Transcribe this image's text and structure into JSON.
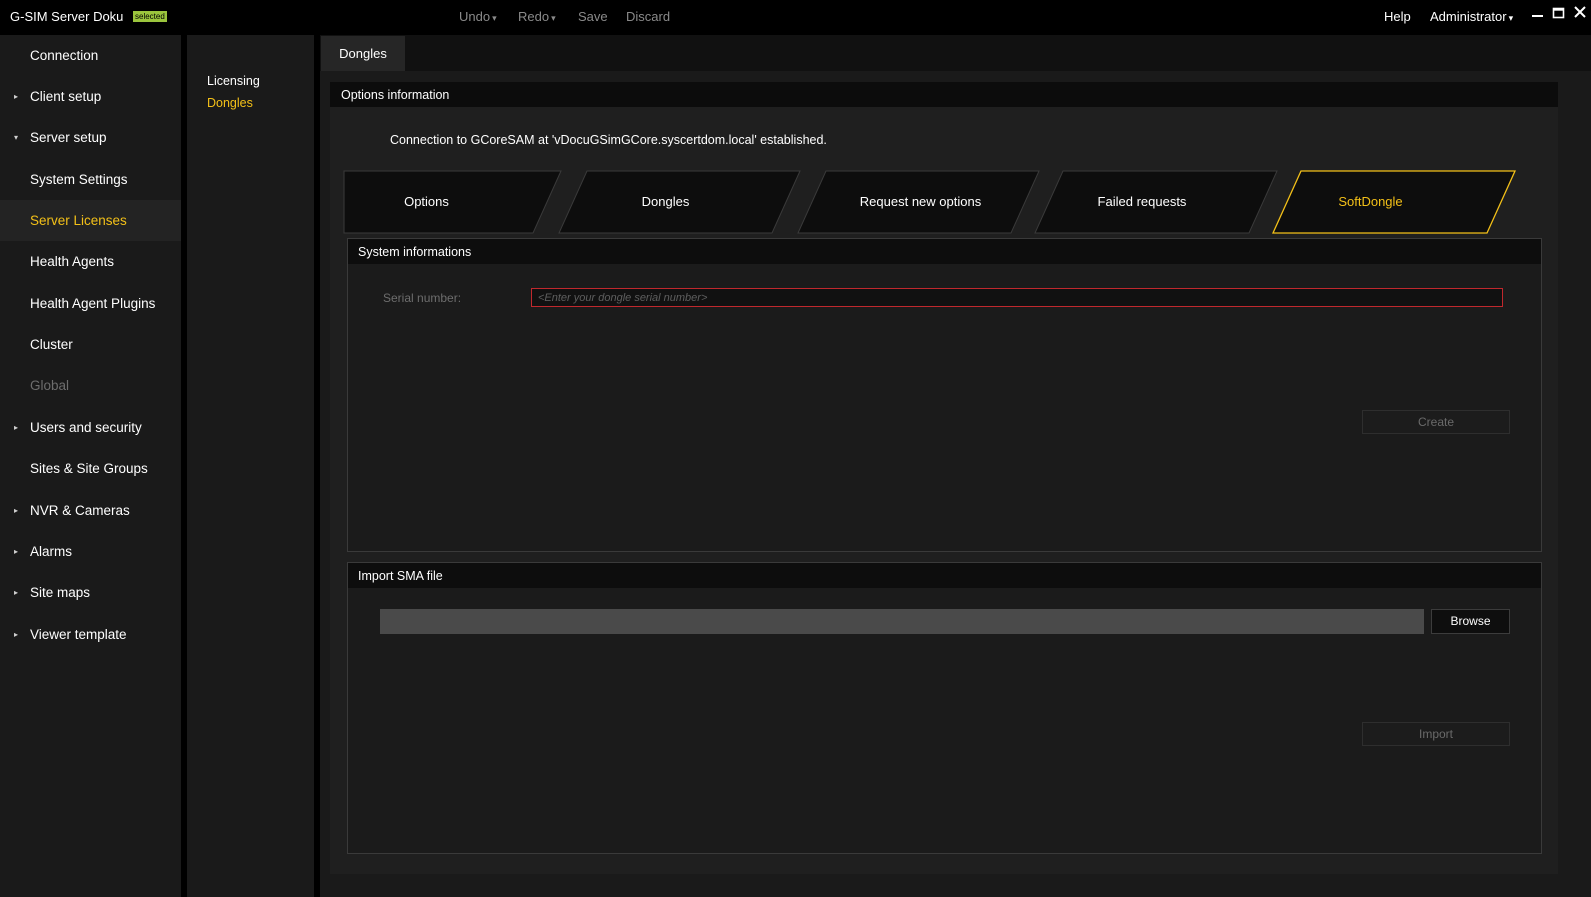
{
  "titlebar": {
    "app_title": "G-SIM Server Doku",
    "badge": "selected",
    "undo": "Undo",
    "redo": "Redo",
    "save": "Save",
    "discard": "Discard",
    "help": "Help",
    "user": "Administrator",
    "dropdown_glyph": "▾"
  },
  "sidebar": {
    "items": [
      {
        "label": "Connection"
      },
      {
        "label": "Client setup",
        "arrow": "▸"
      },
      {
        "label": "Server setup",
        "arrow": "▾"
      },
      {
        "label": "System Settings"
      },
      {
        "label": "Server Licenses"
      },
      {
        "label": "Health Agents"
      },
      {
        "label": "Health Agent Plugins"
      },
      {
        "label": "Cluster"
      },
      {
        "label": "Global"
      },
      {
        "label": "Users and security",
        "arrow": "▸"
      },
      {
        "label": "Sites & Site Groups"
      },
      {
        "label": "NVR & Cameras",
        "arrow": "▸"
      },
      {
        "label": "Alarms",
        "arrow": "▸"
      },
      {
        "label": "Site maps",
        "arrow": "▸"
      },
      {
        "label": "Viewer template",
        "arrow": "▸"
      }
    ]
  },
  "subnav": {
    "licensing": "Licensing",
    "dongles": "Dongles"
  },
  "main": {
    "tab": "Dongles",
    "panel_title": "Options information",
    "status": "Connection to GCoreSAM at 'vDocuGSimGCore.syscertdom.local' established.",
    "tabs": [
      {
        "label": "Options"
      },
      {
        "label": "Dongles"
      },
      {
        "label": "Request new options"
      },
      {
        "label": "Failed requests"
      },
      {
        "label": "SoftDongle"
      }
    ],
    "system_info": {
      "title": "System informations",
      "serial_label": "Serial number:",
      "serial_placeholder": "<Enter your dongle serial number>",
      "serial_value": "",
      "create_button": "Create"
    },
    "import_sma": {
      "title": "Import SMA file",
      "file_value": "",
      "browse_button": "Browse",
      "import_button": "Import"
    }
  },
  "colors": {
    "accent": "#f3c018",
    "error_border": "#c0282d",
    "badge": "#9bc53d"
  }
}
